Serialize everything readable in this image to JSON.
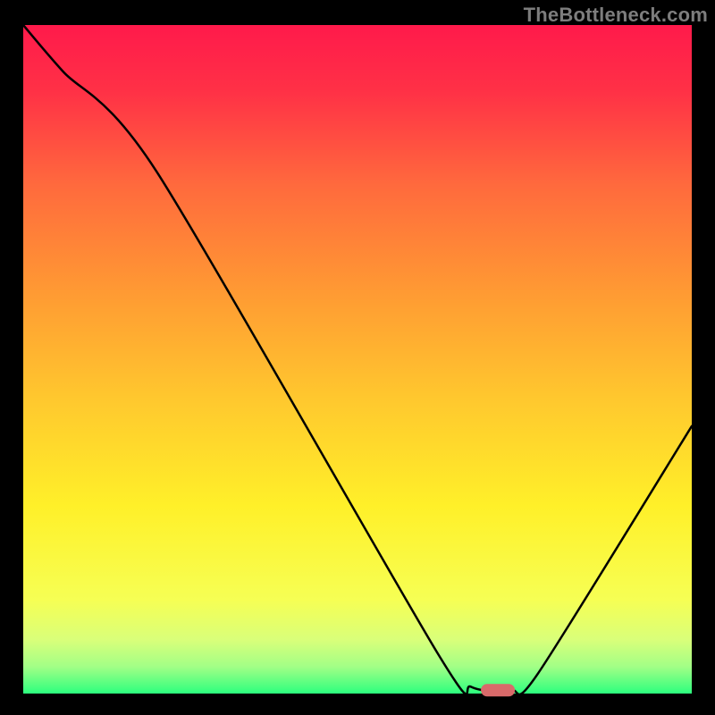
{
  "watermark": "TheBottleneck.com",
  "chart_data": {
    "type": "line",
    "title": "",
    "xlabel": "",
    "ylabel": "",
    "xlim": [
      0,
      100
    ],
    "ylim": [
      0,
      100
    ],
    "x": [
      0,
      6,
      20,
      62,
      67,
      73,
      77,
      100
    ],
    "y": [
      100,
      93,
      78,
      6,
      1,
      0.5,
      3,
      40
    ],
    "marker": {
      "x": 71,
      "y": 0.5,
      "color": "#d86a6a"
    },
    "grid": false,
    "legend": false
  }
}
